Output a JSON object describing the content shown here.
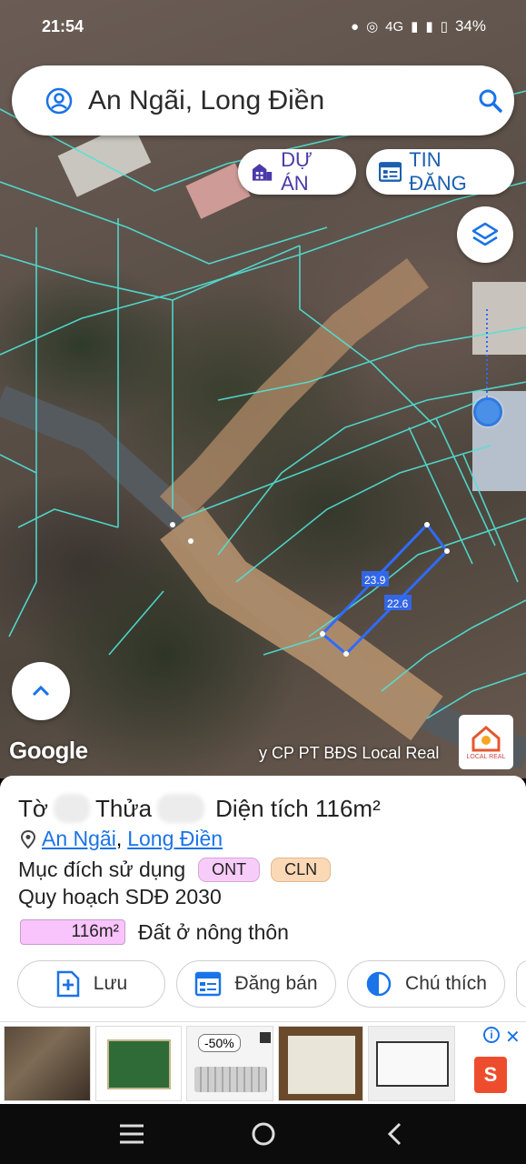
{
  "status_bar": {
    "time": "21:54",
    "network": "4G",
    "battery": "34%"
  },
  "search": {
    "query": "An Ngãi, Long Điền"
  },
  "chips": {
    "du_an": "DỰ ÁN",
    "tin_dang": "TIN ĐĂNG"
  },
  "map": {
    "labels": {
      "edge_a": "23.9",
      "edge_b": "22.6"
    },
    "google_logo": "Google",
    "attribution": "y CP PT BĐS Local Real",
    "badge_text": "LOCAL REAL"
  },
  "parcel": {
    "to_label": "Tờ",
    "thua_label": "Thửa",
    "area_text": "Diện tích 116m²",
    "location": {
      "commune": "An Ngãi",
      "separator": ",",
      "district": "Long Điền"
    },
    "purpose_label": "Mục đích sử dụng",
    "tags": [
      "ONT",
      "CLN"
    ],
    "planning_title": "Quy hoạch SDĐ 2030",
    "planning_area": "116m²",
    "planning_desc": "Đất ở nông thôn"
  },
  "actions": {
    "luu": "Lưu",
    "dang_ban": "Đăng bán",
    "chu_thich": "Chú thích"
  },
  "ad": {
    "discount": "-50%",
    "shop_letter": "S"
  },
  "colors": {
    "accent_blue": "#1a73e8",
    "parcel_line": "#2f6bff",
    "plot_line": "#4fe3d7",
    "ont_tag": "#f7ccf8",
    "cln_tag": "#fcd9b6"
  }
}
